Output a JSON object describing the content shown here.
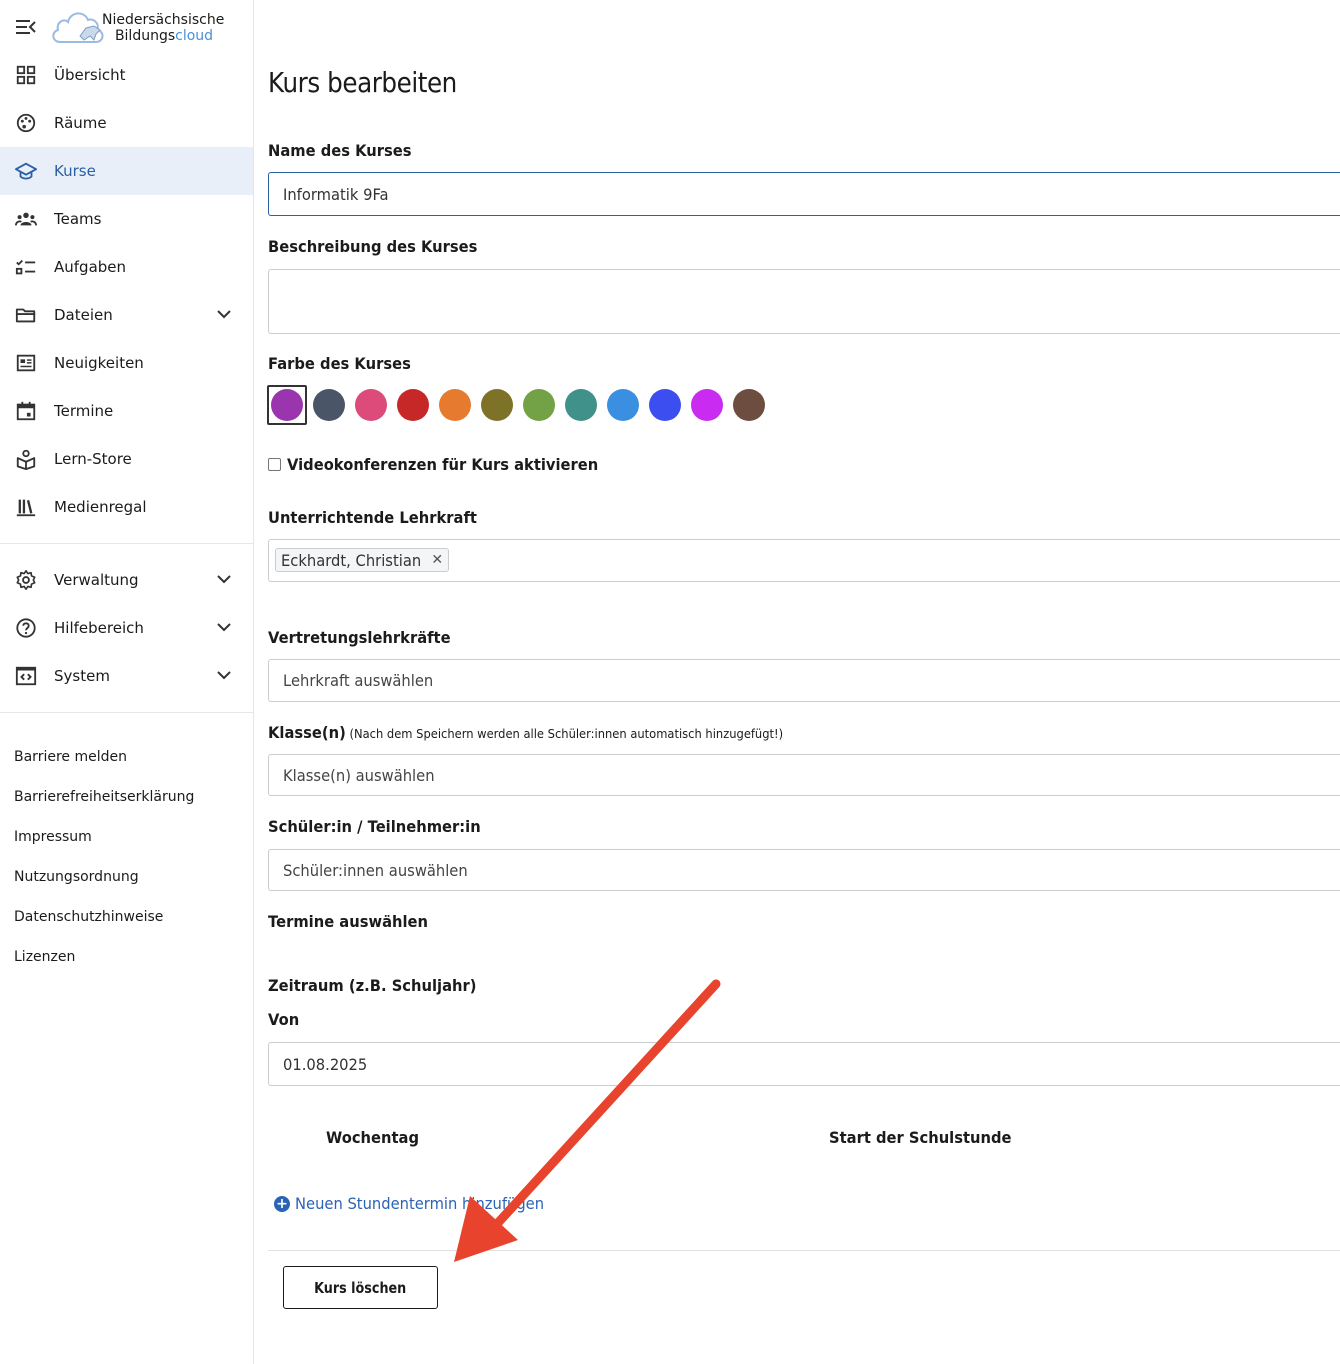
{
  "brand": {
    "line1": "Niedersächsische",
    "line2_a": "Bildungs",
    "line2_b": "cloud"
  },
  "sidebar": {
    "items": [
      {
        "label": "Übersicht",
        "icon": "grid-icon",
        "active": false
      },
      {
        "label": "Räume",
        "icon": "palette-icon",
        "active": false
      },
      {
        "label": "Kurse",
        "icon": "graduation-cap-icon",
        "active": true
      },
      {
        "label": "Teams",
        "icon": "people-icon",
        "active": false
      },
      {
        "label": "Aufgaben",
        "icon": "task-list-icon",
        "active": false
      },
      {
        "label": "Dateien",
        "icon": "folder-icon",
        "active": false,
        "expandable": true
      },
      {
        "label": "Neuigkeiten",
        "icon": "newspaper-icon",
        "active": false
      },
      {
        "label": "Termine",
        "icon": "calendar-icon",
        "active": false
      },
      {
        "label": "Lern-Store",
        "icon": "store-icon",
        "active": false
      },
      {
        "label": "Medienregal",
        "icon": "bookshelf-icon",
        "active": false
      }
    ],
    "admin_items": [
      {
        "label": "Verwaltung",
        "icon": "gear-icon",
        "expandable": true
      },
      {
        "label": "Hilfebereich",
        "icon": "help-circle-icon",
        "expandable": true
      },
      {
        "label": "System",
        "icon": "code-window-icon",
        "expandable": true
      }
    ],
    "footer_links": [
      "Barriere melden",
      "Barrierefreiheitserklärung",
      "Impressum",
      "Nutzungsordnung",
      "Datenschutzhinweise",
      "Lizenzen"
    ]
  },
  "form": {
    "title": "Kurs bearbeiten",
    "name_label": "Name des Kurses",
    "name_value": "Informatik 9Fa",
    "description_label": "Beschreibung des Kurses",
    "description_value": "",
    "color_label": "Farbe des Kurses",
    "colors": [
      "#9b35ae",
      "#4a5568",
      "#dc4b7a",
      "#c62828",
      "#e67a2e",
      "#7d7227",
      "#73a146",
      "#3f9189",
      "#3b8fe0",
      "#3d4ef0",
      "#c92cf0",
      "#6d4d40"
    ],
    "selected_color_index": 0,
    "video_label": "Videokonferenzen für Kurs aktivieren",
    "video_checked": false,
    "teacher_label": "Unterrichtende Lehrkraft",
    "teacher_tag": "Eckhardt, Christian",
    "substitute_label": "Vertretungslehrkräfte",
    "substitute_placeholder": "Lehrkraft auswählen",
    "classes_label": "Klasse(n)",
    "classes_hint": "(Nach dem Speichern werden alle Schüler:innen automatisch hinzugefügt!)",
    "classes_placeholder": "Klasse(n) auswählen",
    "students_label": "Schüler:in / Teilnehmer:in",
    "students_placeholder": "Schüler:innen auswählen",
    "schedule_label": "Termine auswählen",
    "period_label": "Zeitraum (z.B. Schuljahr)",
    "from_label": "Von",
    "from_value": "01.08.2025",
    "weekday_header": "Wochentag",
    "start_header": "Start der Schulstunde",
    "add_lesson_label": "Neuen Stundentermin hinzufügen",
    "delete_button": "Kurs löschen"
  },
  "annotation": {
    "arrow_color": "#e8432d"
  }
}
